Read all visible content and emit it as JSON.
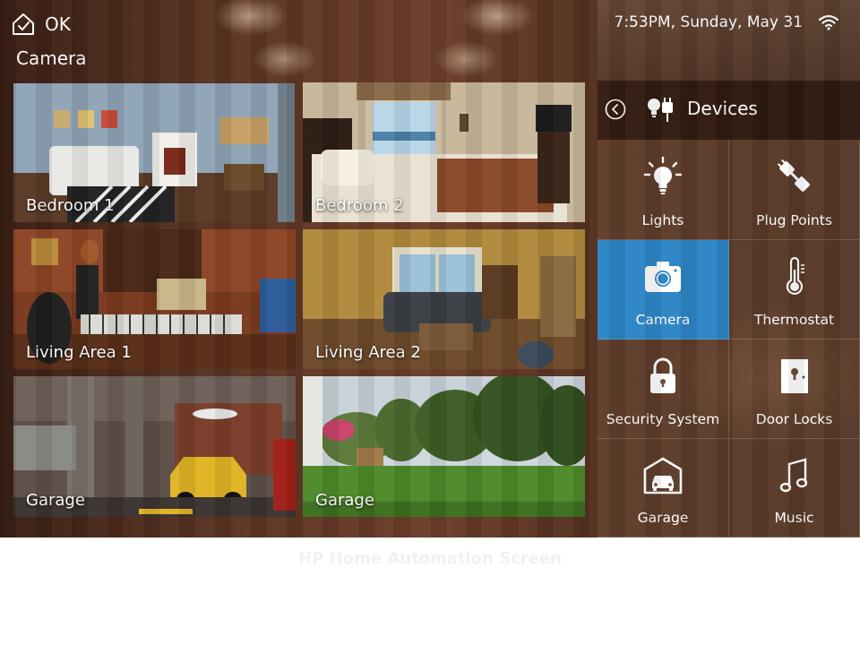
{
  "header": {
    "home_icon": "home-check-icon",
    "ok_label": "OK",
    "section_title": "Camera"
  },
  "status": {
    "clock": "7:53PM, Sunday, May 31",
    "wifi_icon": "wifi-icon"
  },
  "cameras": [
    {
      "label": "Bedroom 1"
    },
    {
      "label": "Bedroom 2"
    },
    {
      "label": "Living Area 1"
    },
    {
      "label": "Living Area  2"
    },
    {
      "label": "Garage"
    },
    {
      "label": "Garage"
    }
  ],
  "devices": {
    "back_icon": "back-arrow-icon",
    "header_icon": "bulb-plug-icon",
    "title": "Devices",
    "active": "Camera",
    "accent_color": "#2d86c7",
    "items": [
      {
        "label": "Lights",
        "icon": "bulb-icon"
      },
      {
        "label": "Plug Points",
        "icon": "plug-icon"
      },
      {
        "label": "Camera",
        "icon": "camera-icon"
      },
      {
        "label": "Thermostat",
        "icon": "thermometer-icon"
      },
      {
        "label": "Security System",
        "icon": "padlock-icon"
      },
      {
        "label": "Door Locks",
        "icon": "door-lock-icon"
      },
      {
        "label": "Garage",
        "icon": "garage-car-icon"
      },
      {
        "label": "Music",
        "icon": "music-note-icon"
      }
    ]
  },
  "footer": {
    "caption": "HP Home Automation Screen"
  }
}
